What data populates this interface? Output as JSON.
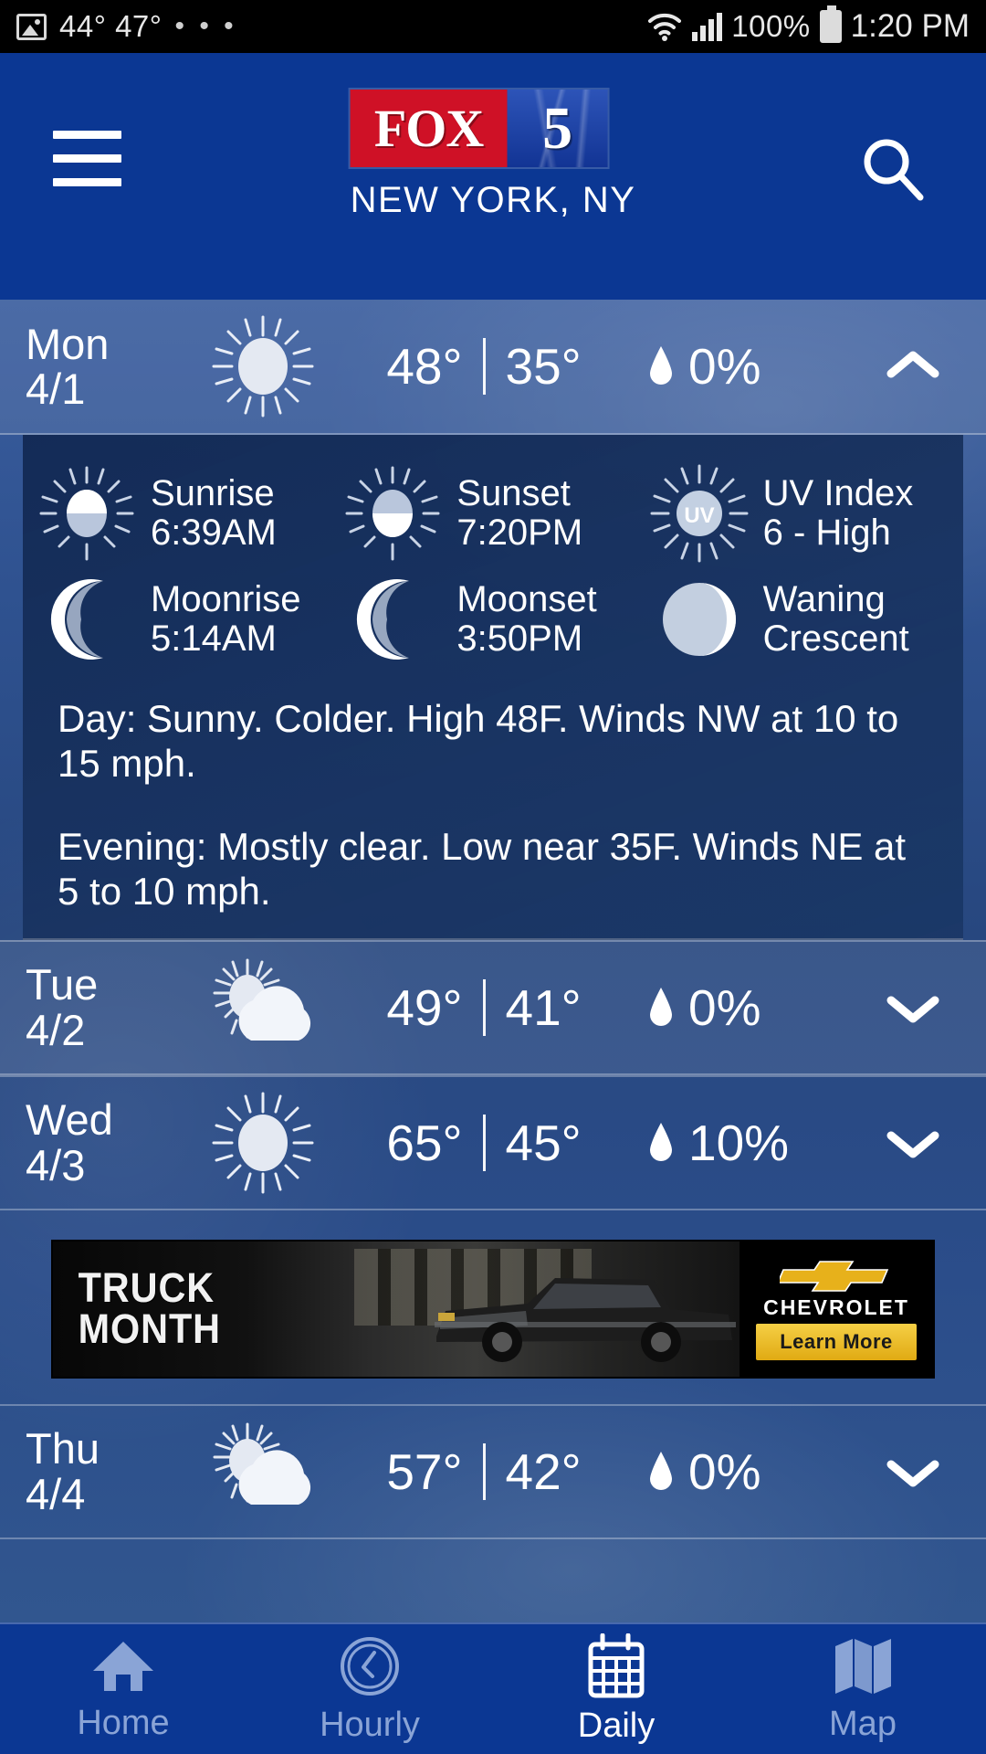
{
  "status_bar": {
    "image_icon": "image-icon",
    "temps": "44° 47°",
    "more": "• • •",
    "wifi_icon": "wifi-icon",
    "signal_icon": "signal-icon",
    "battery_percent": "100%",
    "battery_icon": "battery-icon",
    "time": "1:20 PM"
  },
  "header": {
    "menu_icon": "hamburger-menu-icon",
    "logo_fox": "FOX",
    "logo_five": "5",
    "market": "NEW YORK, NY",
    "search_icon": "search-icon",
    "brand_red": "#cf1126",
    "brand_blue": "#0b3793"
  },
  "days": [
    {
      "name": "Mon",
      "date": "4/1",
      "icon": "sunny-icon",
      "high": "48°",
      "sep": "|",
      "low": "35°",
      "precip_icon": "water-drop-icon",
      "precip": "0%",
      "toggle_icon": "chevron-up-icon",
      "expanded": true
    },
    {
      "name": "Tue",
      "date": "4/2",
      "icon": "partly-cloudy-icon",
      "high": "49°",
      "sep": "|",
      "low": "41°",
      "precip_icon": "water-drop-icon",
      "precip": "0%",
      "toggle_icon": "chevron-down-icon",
      "expanded": false
    },
    {
      "name": "Wed",
      "date": "4/3",
      "icon": "sunny-icon",
      "high": "65°",
      "sep": "|",
      "low": "45°",
      "precip_icon": "water-drop-icon",
      "precip": "10%",
      "toggle_icon": "chevron-down-icon",
      "expanded": false
    },
    {
      "name": "Thu",
      "date": "4/4",
      "icon": "partly-cloudy-icon",
      "high": "57°",
      "sep": "|",
      "low": "42°",
      "precip_icon": "water-drop-icon",
      "precip": "0%",
      "toggle_icon": "chevron-down-icon",
      "expanded": false
    }
  ],
  "detail": {
    "sunrise_label": "Sunrise",
    "sunrise_value": "6:39AM",
    "sunrise_icon": "sunrise-icon",
    "sunset_label": "Sunset",
    "sunset_value": "7:20PM",
    "sunset_icon": "sunset-icon",
    "uv_label": "UV Index",
    "uv_value": "6 - High",
    "uv_icon": "uv-index-icon",
    "uv_glyph": "UV",
    "moonrise_label": "Moonrise",
    "moonrise_value": "5:14AM",
    "moonrise_icon": "moonrise-icon",
    "moonset_label": "Moonset",
    "moonset_value": "3:50PM",
    "moonset_icon": "moonset-icon",
    "moonphase_label": "Waning",
    "moonphase_value": "Crescent",
    "moonphase_icon": "moon-phase-icon",
    "day_forecast": "Day: Sunny. Colder. High 48F. Winds NW at 10 to 15 mph.",
    "evening_forecast": "Evening: Mostly clear. Low near 35F. Winds NE at 5 to 10 mph."
  },
  "ad": {
    "headline_line1": "TRUCK",
    "headline_line2": "MONTH",
    "brand": "CHEVROLET",
    "cta": "Learn More",
    "logo_icon": "chevrolet-bowtie-icon",
    "cta_color": "#e9bb28"
  },
  "bottom_nav": {
    "items": [
      {
        "label": "Home",
        "icon": "home-icon",
        "active": false
      },
      {
        "label": "Hourly",
        "icon": "clock-icon",
        "active": false
      },
      {
        "label": "Daily",
        "icon": "calendar-icon",
        "active": true
      },
      {
        "label": "Map",
        "icon": "map-icon",
        "active": false
      }
    ]
  }
}
